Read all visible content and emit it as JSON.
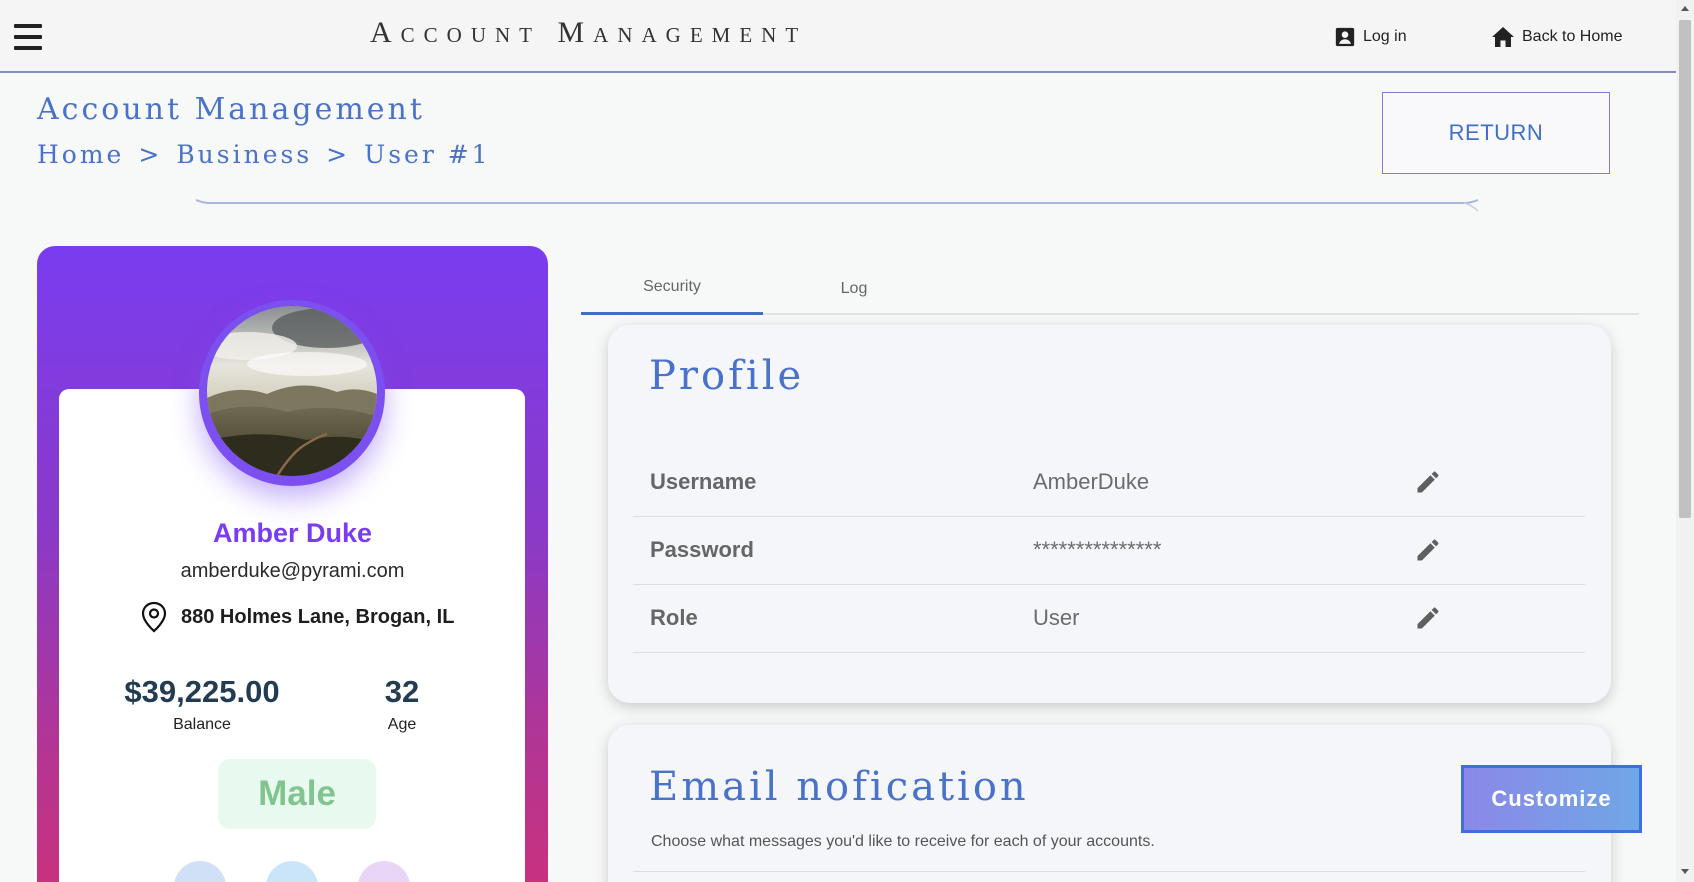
{
  "header": {
    "app_title": "Account Management",
    "login_label": "Log in",
    "home_label": "Back to Home"
  },
  "page": {
    "heading": "Account Management",
    "breadcrumb": [
      "Home",
      ">",
      "Business",
      ">",
      "User #1"
    ],
    "return_label": "RETURN"
  },
  "user": {
    "name": "Amber Duke",
    "email": "amberduke@pyrami.com",
    "address": "880 Holmes Lane, Brogan, IL",
    "balance": "$39,225.00",
    "balance_label": "Balance",
    "age": "32",
    "age_label": "Age",
    "gender": "Male"
  },
  "tabs": [
    {
      "label": "Security",
      "active": true
    },
    {
      "label": "Log",
      "active": false
    }
  ],
  "profile": {
    "title": "Profile",
    "fields": [
      {
        "label": "Username",
        "value": "AmberDuke"
      },
      {
        "label": "Password",
        "value": "***************"
      },
      {
        "label": "Role",
        "value": "User"
      }
    ]
  },
  "email_notification": {
    "title": "Email nofication",
    "subtitle": "Choose what messages you'd like to receive for each of your accounts.",
    "customize_label": "Customize"
  },
  "colors": {
    "accent_blue": "#4a72c8",
    "card_gradient_top": "#7a3cf0",
    "card_gradient_bottom": "#c8327e",
    "gender_badge_bg": "#e8f9ef",
    "gender_badge_text": "#82c48f"
  },
  "icons": {
    "menu": "hamburger-menu-icon",
    "login": "account-box-icon",
    "home": "home-icon",
    "location": "location-pin-icon",
    "edit": "pencil-icon"
  }
}
